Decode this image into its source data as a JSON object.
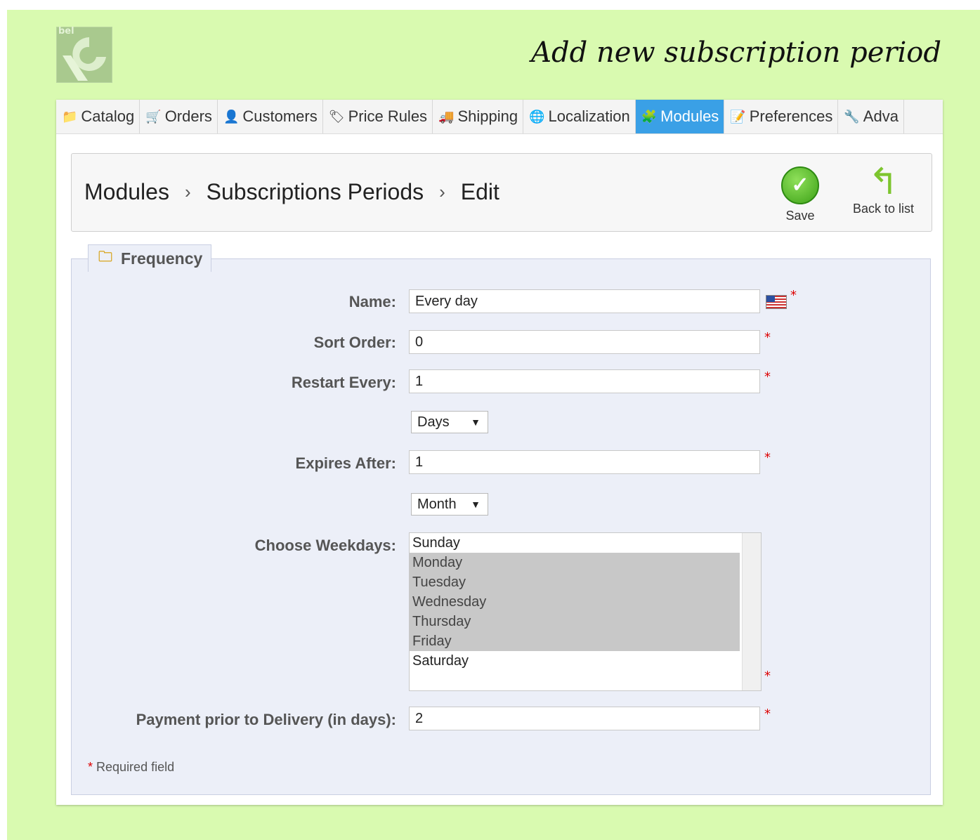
{
  "page": {
    "title": "Add new subscription period",
    "logo_text": "bel"
  },
  "tabs": [
    {
      "label": "Catalog",
      "icon": "folder-icon",
      "glyph": "📁"
    },
    {
      "label": "Orders",
      "icon": "cart-icon",
      "glyph": "🛒"
    },
    {
      "label": "Customers",
      "icon": "user-icon",
      "glyph": "👤"
    },
    {
      "label": "Price Rules",
      "icon": "price-rules-icon",
      "glyph": "🏷"
    },
    {
      "label": "Shipping",
      "icon": "truck-icon",
      "glyph": "🚚"
    },
    {
      "label": "Localization",
      "icon": "globe-icon",
      "glyph": "🌐"
    },
    {
      "label": "Modules",
      "icon": "puzzle-icon",
      "glyph": "🧩",
      "active": true
    },
    {
      "label": "Preferences",
      "icon": "preferences-icon",
      "glyph": "📝"
    },
    {
      "label": "Adva",
      "icon": "wrench-icon",
      "glyph": "🔧"
    }
  ],
  "breadcrumb": {
    "items": [
      "Modules",
      "Subscriptions Periods",
      "Edit"
    ],
    "separator": "›"
  },
  "toolbar": {
    "save_label": "Save",
    "back_label": "Back to list"
  },
  "form": {
    "legend": "Frequency",
    "name_label": "Name:",
    "name_value": "Every day",
    "sort_order_label": "Sort Order:",
    "sort_order_value": "0",
    "restart_every_label": "Restart Every:",
    "restart_every_value": "1",
    "restart_unit": "Days",
    "expires_after_label": "Expires After:",
    "expires_after_value": "1",
    "expires_unit": "Month",
    "weekdays_label": "Choose Weekdays:",
    "weekdays": [
      {
        "label": "Sunday",
        "selected": false
      },
      {
        "label": "Monday",
        "selected": true
      },
      {
        "label": "Tuesday",
        "selected": true
      },
      {
        "label": "Wednesday",
        "selected": true
      },
      {
        "label": "Thursday",
        "selected": true
      },
      {
        "label": "Friday",
        "selected": true
      },
      {
        "label": "Saturday",
        "selected": false
      }
    ],
    "payment_label": "Payment prior to Delivery (in days):",
    "payment_value": "2",
    "required_star": "*",
    "required_note": "Required field"
  },
  "colors": {
    "background": "#d9fab0",
    "active_tab": "#3aa0e6",
    "fieldset_bg": "#eceff8",
    "required": "#dd0000"
  }
}
